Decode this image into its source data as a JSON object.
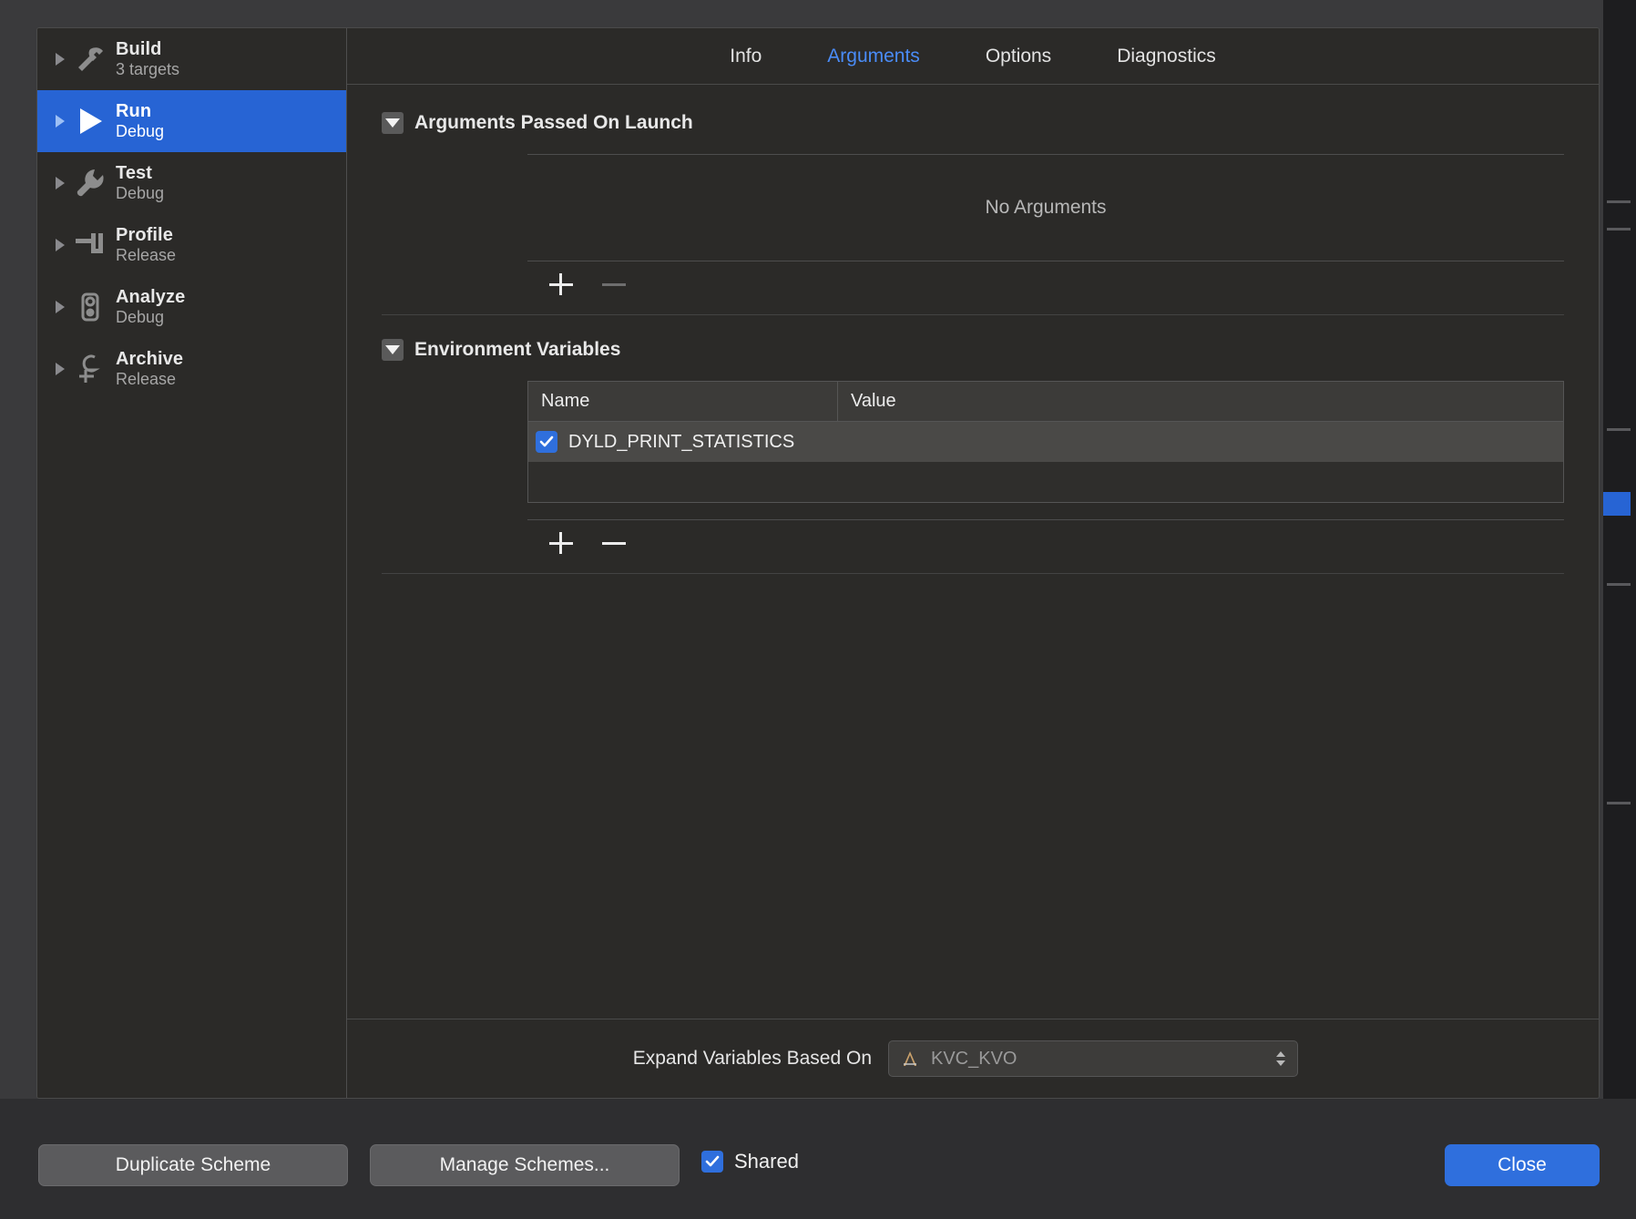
{
  "sidebar": {
    "items": [
      {
        "title": "Build",
        "subtitle": "3 targets",
        "icon": "hammer-icon",
        "selected": false
      },
      {
        "title": "Run",
        "subtitle": "Debug",
        "icon": "play-icon",
        "selected": true
      },
      {
        "title": "Test",
        "subtitle": "Debug",
        "icon": "wrench-icon",
        "selected": false
      },
      {
        "title": "Profile",
        "subtitle": "Release",
        "icon": "caliper-icon",
        "selected": false
      },
      {
        "title": "Analyze",
        "subtitle": "Debug",
        "icon": "magnifier-icon",
        "selected": false
      },
      {
        "title": "Archive",
        "subtitle": "Release",
        "icon": "clamp-icon",
        "selected": false
      }
    ]
  },
  "tabs": [
    {
      "label": "Info",
      "active": false
    },
    {
      "label": "Arguments",
      "active": true
    },
    {
      "label": "Options",
      "active": false
    },
    {
      "label": "Diagnostics",
      "active": false
    }
  ],
  "arguments_section": {
    "title": "Arguments Passed On Launch",
    "expanded": true,
    "empty_message": "No Arguments",
    "add_label": "+",
    "remove_label": "—",
    "remove_enabled": false
  },
  "environment_section": {
    "title": "Environment Variables",
    "expanded": true,
    "columns": [
      "Name",
      "Value"
    ],
    "rows": [
      {
        "checked": true,
        "name": "DYLD_PRINT_STATISTICS",
        "value": ""
      }
    ],
    "add_label": "+",
    "remove_label": "—",
    "remove_enabled": true
  },
  "expand_variables": {
    "label": "Expand Variables Based On",
    "selected": "KVC_KVO",
    "icon": "xcode-project-icon"
  },
  "footer": {
    "duplicate_scheme": "Duplicate Scheme",
    "manage_schemes": "Manage Schemes...",
    "shared_label": "Shared",
    "shared_checked": true,
    "close": "Close"
  },
  "colors": {
    "accent": "#2f6fdd",
    "tab_active": "#4a8cf7",
    "sheet_bg": "#2b2a28",
    "window_bg": "#2e2e30"
  }
}
